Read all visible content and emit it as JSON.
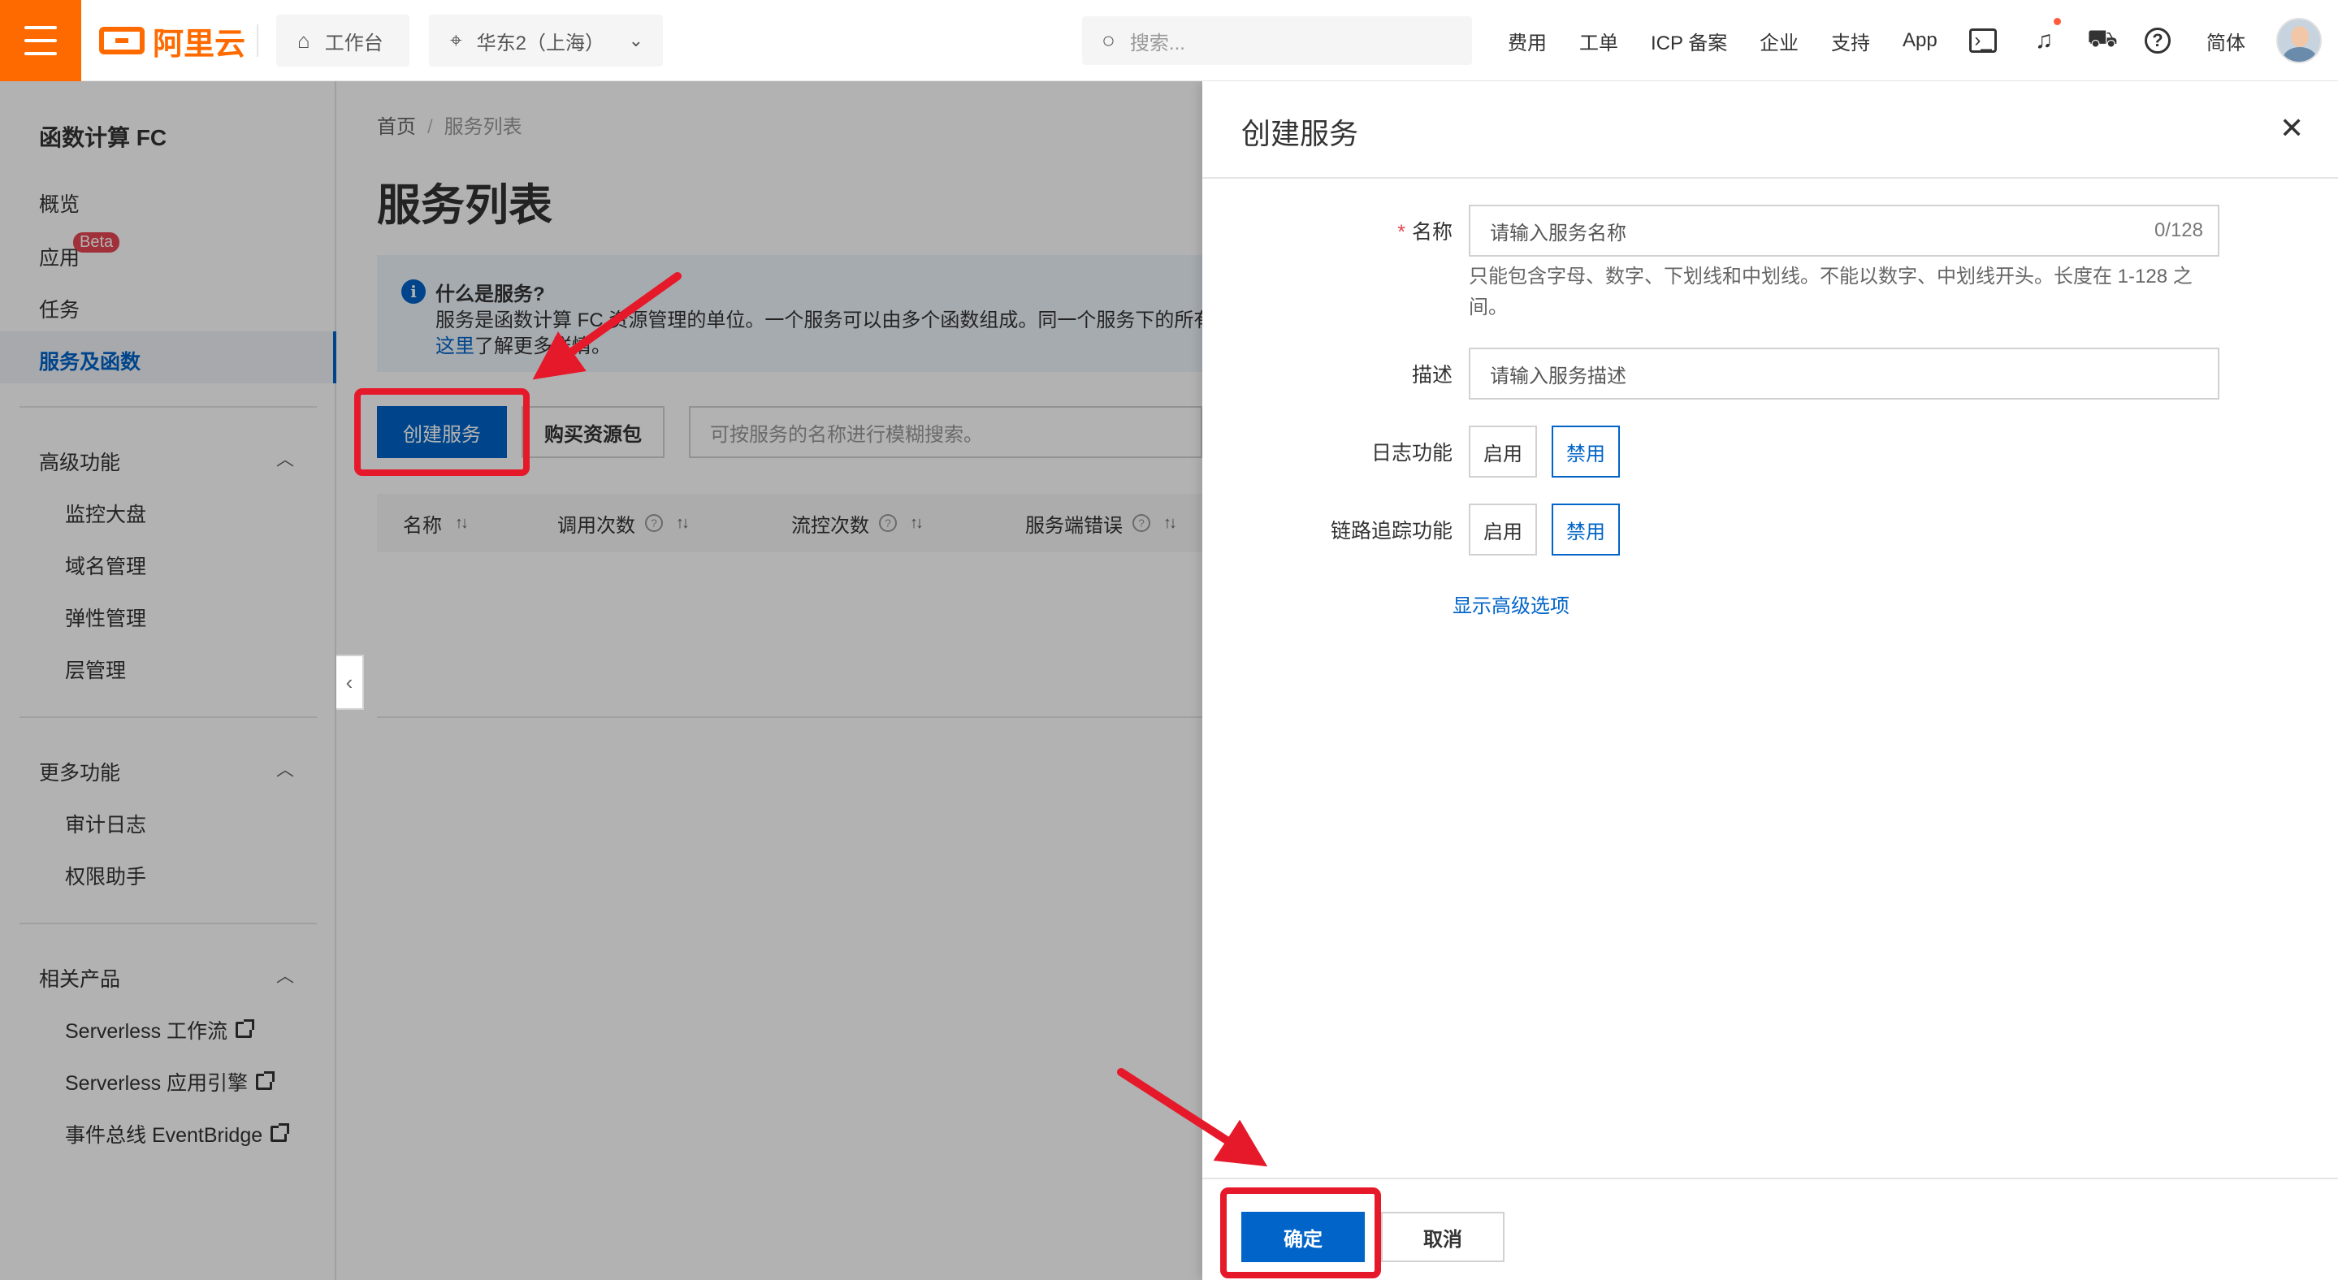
{
  "topbar": {
    "logo_text": "阿里云",
    "workbench_label": "工作台",
    "region_label": "华东2（上海）",
    "search_placeholder": "搜索...",
    "nav": [
      "费用",
      "工单",
      "ICP 备案",
      "企业",
      "支持",
      "App"
    ],
    "lang_label": "简体",
    "icons": [
      "menu-icon",
      "home-icon",
      "location-pin-icon",
      "chevron-down-icon",
      "search-icon",
      "terminal-icon",
      "bell-icon",
      "cart-icon",
      "help-icon"
    ]
  },
  "sidebar": {
    "title": "函数计算 FC",
    "items": [
      "概览",
      "应用",
      "任务",
      "服务及函数"
    ],
    "beta_badge": "Beta",
    "sections": [
      {
        "title": "高级功能",
        "items": [
          "监控大盘",
          "域名管理",
          "弹性管理",
          "层管理"
        ]
      },
      {
        "title": "更多功能",
        "items": [
          "审计日志",
          "权限助手"
        ]
      },
      {
        "title": "相关产品",
        "items": [
          "Serverless 工作流",
          "Serverless 应用引擎",
          "事件总线 EventBridge"
        ]
      }
    ]
  },
  "main": {
    "breadcrumb": [
      "首页",
      "服务列表"
    ],
    "title": "服务列表",
    "info": {
      "title": "什么是服务?",
      "desc": "服务是函数计算 FC 资源管理的单位。一个服务可以由多个函数组成。同一个服务下的所有",
      "link": "这里",
      "link_suffix": "了解更多详情。"
    },
    "create_button": "创建服务",
    "buy_button": "购买资源包",
    "search_placeholder": "可按服务的名称进行模糊搜索。",
    "columns": [
      "名称",
      "调用次数",
      "流控次数",
      "服务端错误"
    ]
  },
  "drawer": {
    "title": "创建服务",
    "fields": {
      "name_label": "名称",
      "name_placeholder": "请输入服务名称",
      "name_count": "0/128",
      "name_help": "只能包含字母、数字、下划线和中划线。不能以数字、中划线开头。长度在 1-128 之间。",
      "desc_label": "描述",
      "desc_placeholder": "请输入服务描述",
      "log_label": "日志功能",
      "trace_label": "链路追踪功能",
      "enable": "启用",
      "disable": "禁用"
    },
    "advanced_link": "显示高级选项",
    "ok_button": "确定",
    "cancel_button": "取消"
  },
  "colors": {
    "brand": "#ff6a00",
    "primary": "#0064c8",
    "annotation": "#e6192a"
  }
}
